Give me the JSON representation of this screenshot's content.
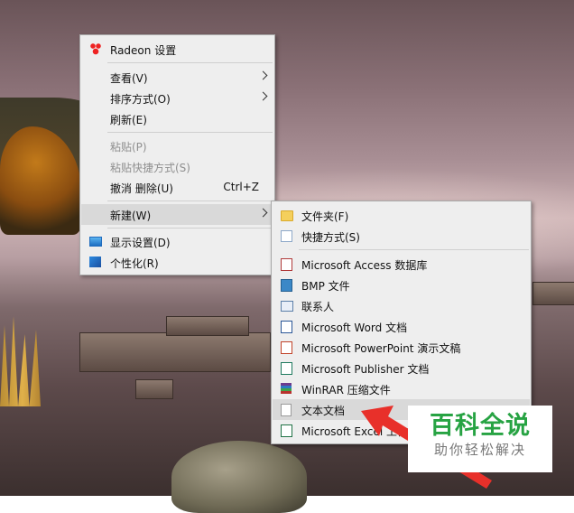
{
  "desktop_menu": {
    "items": [
      {
        "label": "Radeon 设置",
        "icon": "radeon-icon"
      },
      {
        "label": "查看(V)",
        "submenu": true
      },
      {
        "label": "排序方式(O)",
        "submenu": true
      },
      {
        "label": "刷新(E)"
      },
      {
        "label": "粘贴(P)",
        "disabled": true
      },
      {
        "label": "粘贴快捷方式(S)",
        "disabled": true
      },
      {
        "label": "撤消 删除(U)",
        "shortcut": "Ctrl+Z"
      },
      {
        "label": "新建(W)",
        "submenu": true,
        "highlighted": true
      },
      {
        "label": "显示设置(D)",
        "icon": "display-settings-icon"
      },
      {
        "label": "个性化(R)",
        "icon": "personalize-icon"
      }
    ]
  },
  "new_submenu": {
    "items": [
      {
        "label": "文件夹(F)",
        "icon": "folder-icon"
      },
      {
        "label": "快捷方式(S)",
        "icon": "shortcut-icon"
      },
      {
        "label": "Microsoft Access 数据库",
        "icon": "access-icon"
      },
      {
        "label": "BMP 文件",
        "icon": "bmp-icon"
      },
      {
        "label": "联系人",
        "icon": "contact-icon"
      },
      {
        "label": "Microsoft Word 文档",
        "icon": "word-icon"
      },
      {
        "label": "Microsoft PowerPoint 演示文稿",
        "icon": "powerpoint-icon"
      },
      {
        "label": "Microsoft Publisher 文档",
        "icon": "publisher-icon"
      },
      {
        "label": "WinRAR 压缩文件",
        "icon": "winrar-icon"
      },
      {
        "label": "文本文档",
        "icon": "text-document-icon",
        "highlighted": true
      },
      {
        "label": "Microsoft Excel 工作表",
        "icon": "excel-icon"
      }
    ]
  },
  "watermark": {
    "title": "百科全说",
    "subtitle": "助你轻松解决"
  },
  "colors": {
    "menu_bg": "#eeeeee",
    "menu_hover": "#d9d9d9",
    "arrow_red": "#e8302a",
    "watermark_green": "#27a343"
  }
}
